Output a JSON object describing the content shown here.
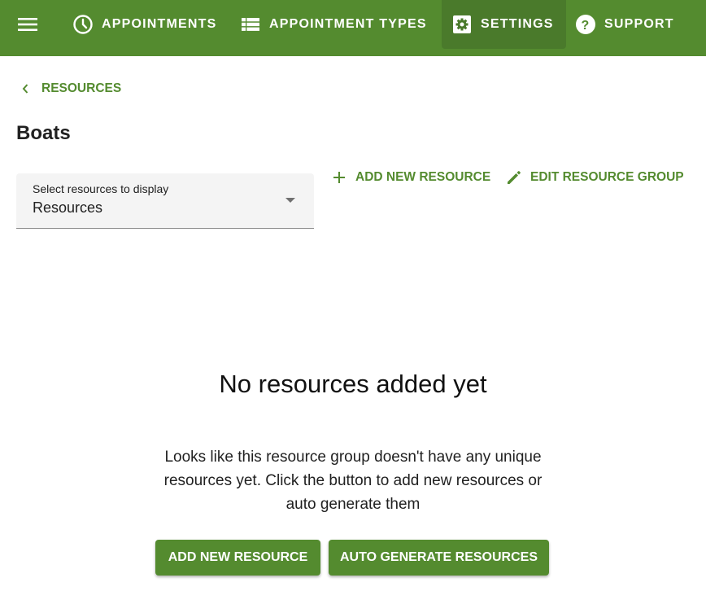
{
  "topbar": {
    "background": "#548b2f",
    "active_background": "#4a7a2b",
    "menu_icon": "hamburger-menu-icon",
    "nav": [
      {
        "label": "APPOINTMENTS",
        "icon": "clock-icon"
      },
      {
        "label": "APPOINTMENT TYPES",
        "icon": "list-icon"
      },
      {
        "label": "SETTINGS",
        "icon": "gear-icon",
        "active": true
      },
      {
        "label": "SUPPORT",
        "icon": "help-circle-icon"
      }
    ]
  },
  "breadcrumb": {
    "back_label": "RESOURCES",
    "icon": "chevron-left-icon"
  },
  "page": {
    "title": "Boats"
  },
  "select": {
    "label": "Select resources to display",
    "value": "Resources"
  },
  "actions": {
    "add_new_resource": "ADD NEW RESOURCE",
    "edit_resource_group": "EDIT RESOURCE GROUP"
  },
  "empty_state": {
    "title": "No resources added yet",
    "description": "Looks like this resource group doesn't have any unique resources yet. Click the button to add new resources or auto generate them",
    "buttons": {
      "add_new_resource": "ADD NEW RESOURCE",
      "auto_generate": "AUTO GENERATE RESOURCES"
    }
  },
  "colors": {
    "accent": "#548b2f"
  }
}
